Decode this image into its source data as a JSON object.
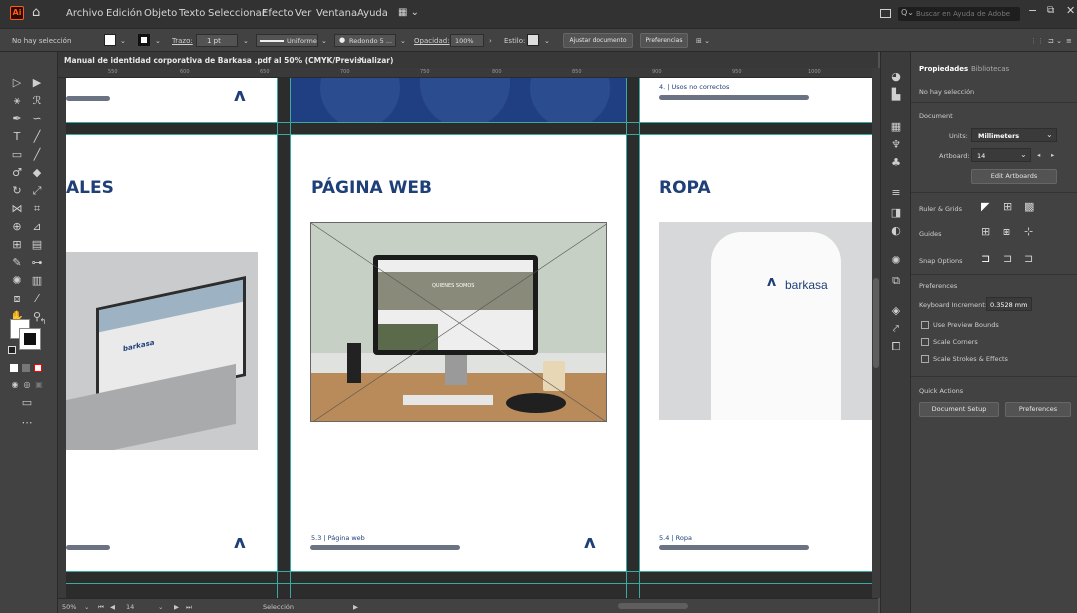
{
  "menubar": {
    "items": [
      "Archivo",
      "Edición",
      "Objeto",
      "Texto",
      "Seleccionar",
      "Efecto",
      "Ver",
      "Ventana",
      "Ayuda"
    ],
    "search_placeholder": "Buscar en Ayuda de Adobe"
  },
  "control_bar": {
    "selection": "No hay selección",
    "trazo_label": "Trazo:",
    "stroke_weight": "1 pt",
    "profile": "Uniforme",
    "brush": "Redondo 5 ...",
    "opacity_label": "Opacidad:",
    "opacity_value": "100%",
    "style_label": "Estilo:",
    "fit_button": "Ajustar documento",
    "prefs_button": "Preferencias"
  },
  "document": {
    "tab_title": "Manual de identidad corporativa de Barkasa .pdf al 50% (CMYK/Previsualizar)",
    "ruler_ticks": [
      "550",
      "600",
      "650",
      "700",
      "750",
      "800",
      "850",
      "900",
      "950",
      "1000"
    ]
  },
  "artboards": {
    "left_heading": "ALES",
    "center_heading": "PÁGINA WEB",
    "right_heading": "ROPA",
    "top_right_caption": "4. | Usos no correctos",
    "center_caption": "5.3 | Página web",
    "right_caption": "5.4 | Ropa",
    "website_heading": "QUIENES SOMOS",
    "brand": "barkasa",
    "laptop_brand": "barkasa"
  },
  "status": {
    "zoom": "50%",
    "artboard_number": "14",
    "tool": "Selección"
  },
  "properties": {
    "tab_properties": "Propiedades",
    "tab_libraries": "Bibliotecas",
    "no_selection": "No hay selección",
    "document_label": "Document",
    "units_label": "Units:",
    "units_value": "Millimeters",
    "artboard_label": "Artboard:",
    "artboard_value": "14",
    "edit_artboards": "Edit Artboards",
    "ruler_grids": "Ruler & Grids",
    "guides": "Guides",
    "snap_options": "Snap Options",
    "preferences_label": "Preferences",
    "keyboard_increment_label": "Keyboard Increment:",
    "keyboard_increment_value": "0.3528 mm",
    "use_preview_bounds": "Use Preview Bounds",
    "scale_corners": "Scale Corners",
    "scale_strokes": "Scale Strokes & Effects",
    "quick_actions": "Quick Actions",
    "document_setup": "Document Setup",
    "preferences_button": "Preferences"
  },
  "colors": {
    "brand_blue": "#1f3f79",
    "guide": "#3aa9a0",
    "app_logo": "#ff5c1a"
  }
}
